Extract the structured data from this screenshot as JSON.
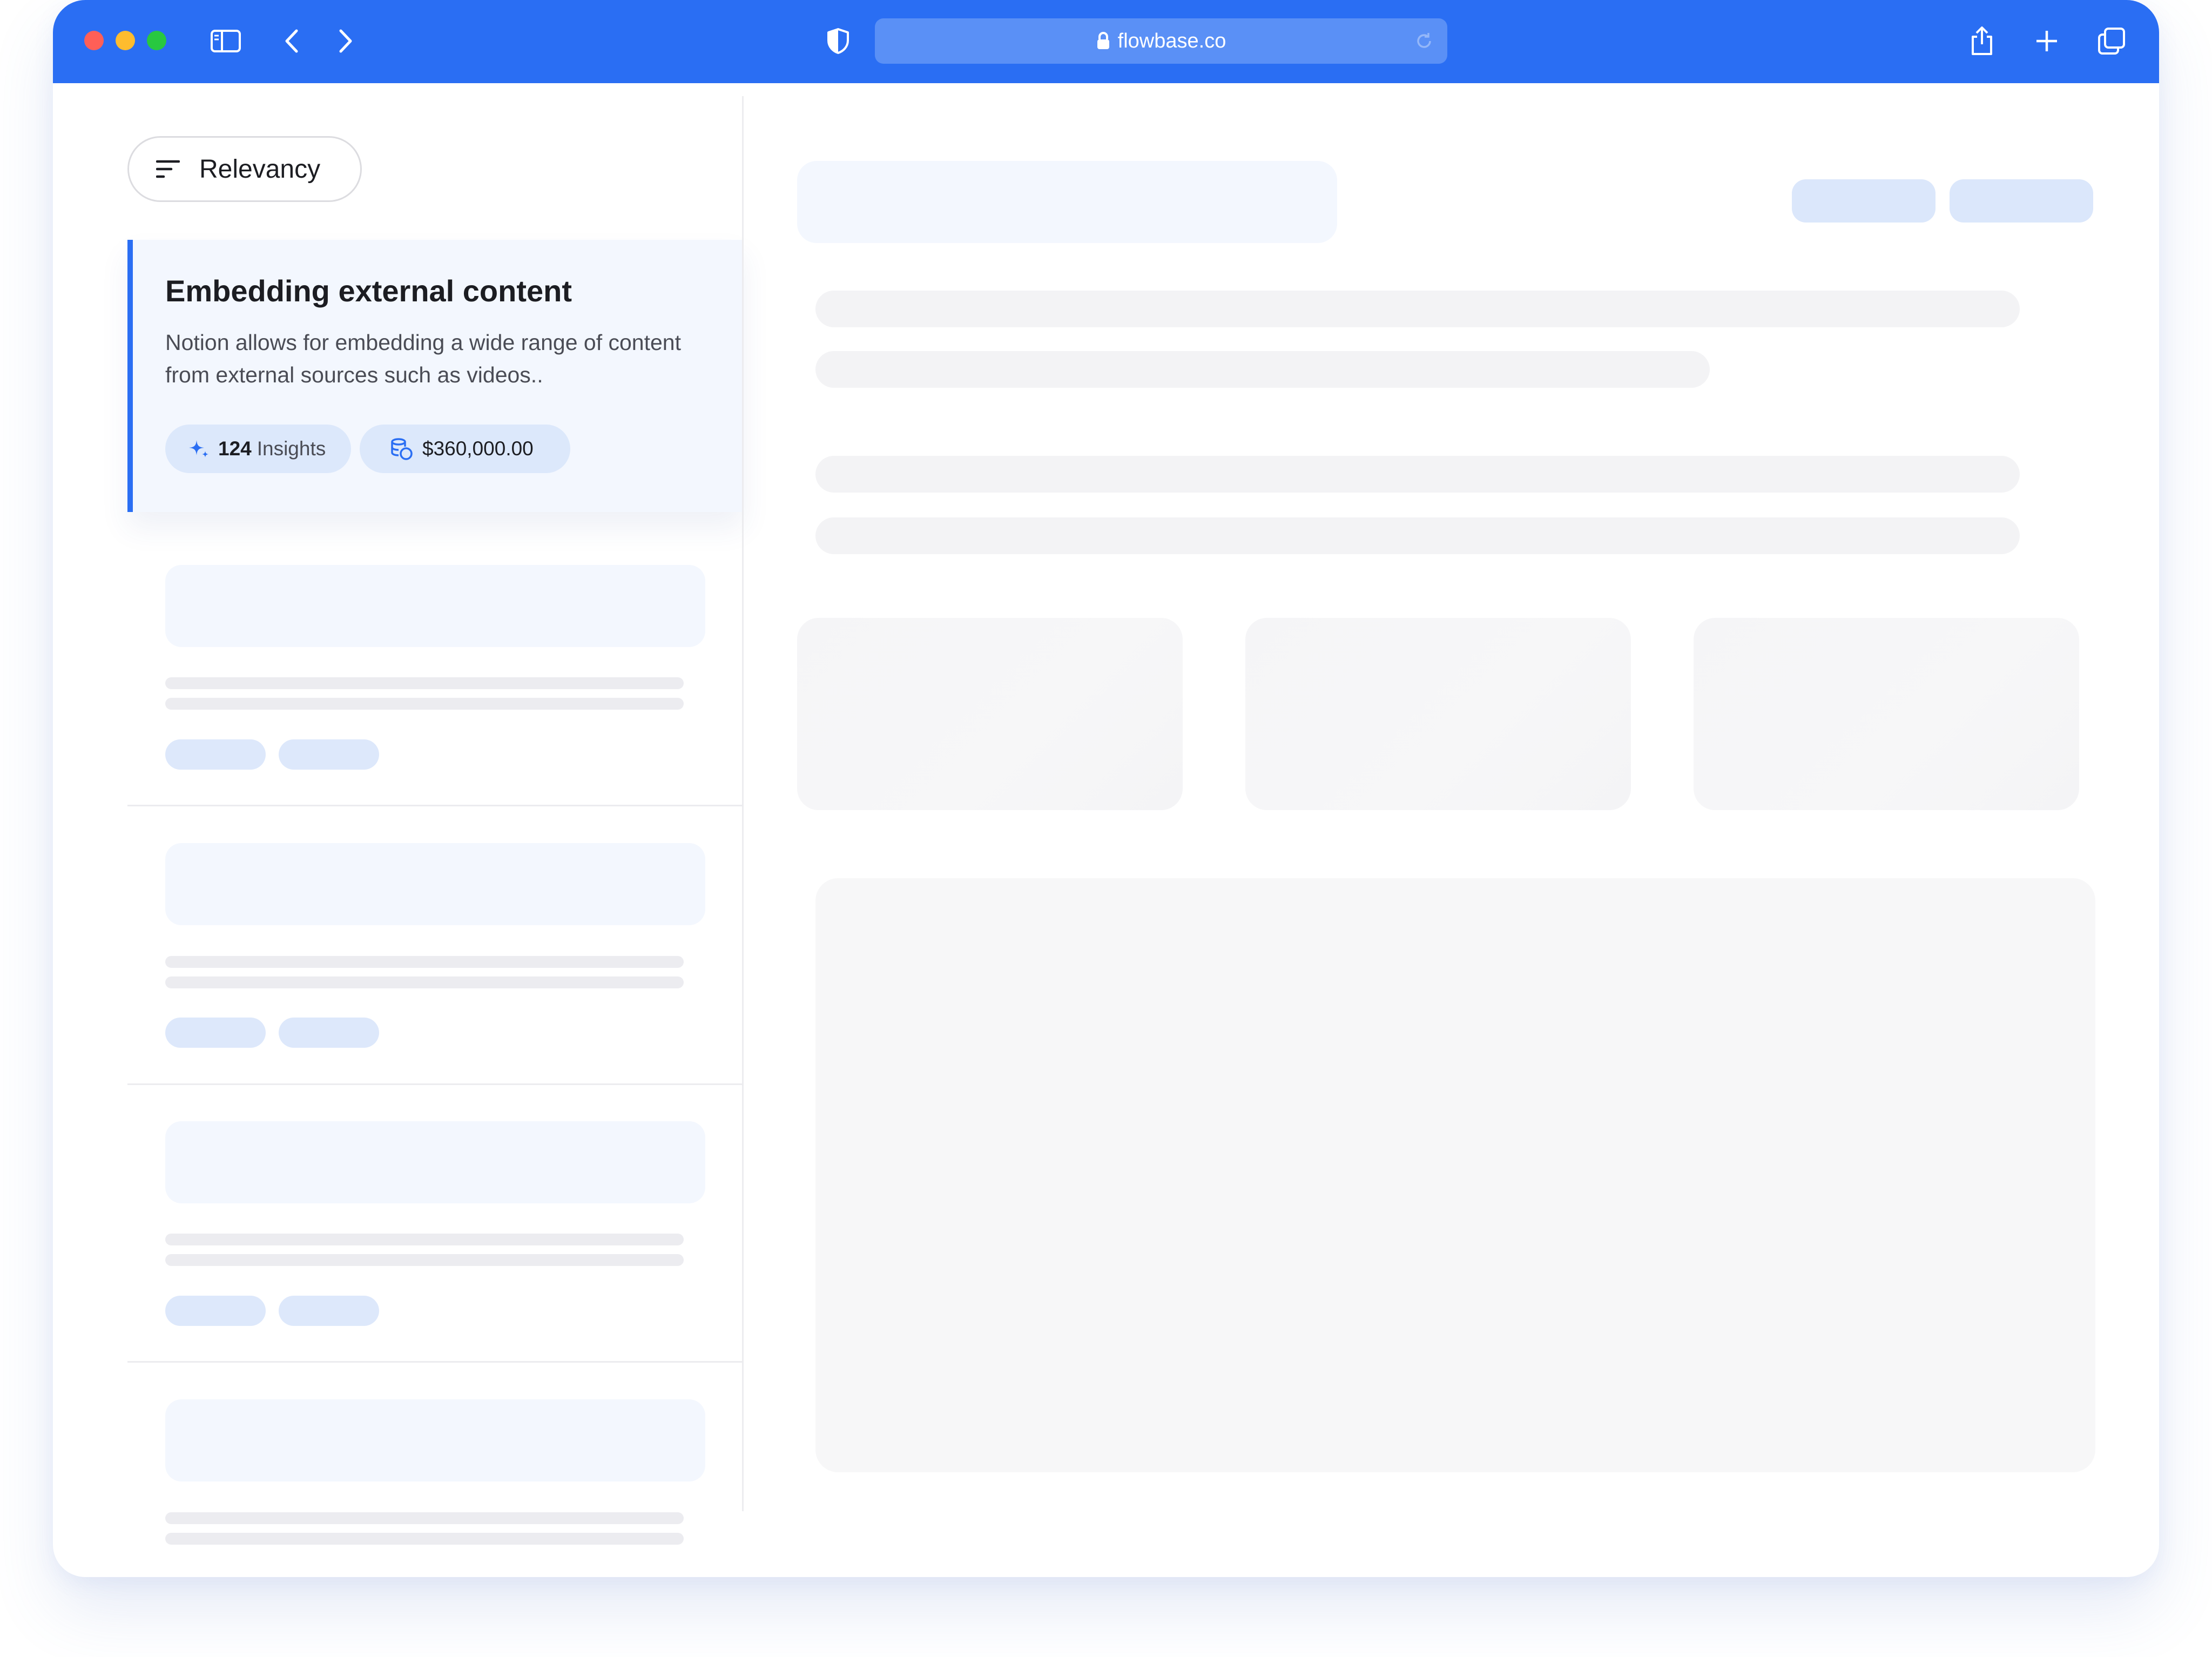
{
  "browser": {
    "url": "flowbase.co",
    "colors": {
      "chrome": "#2a6ef3",
      "address_bar": "#5a90f6"
    },
    "icons": [
      "sidebar-icon",
      "chevron-left-icon",
      "chevron-right-icon",
      "shield-icon",
      "lock-icon",
      "reload-icon",
      "share-icon",
      "plus-icon",
      "tabs-icon"
    ]
  },
  "sidebar": {
    "sort": {
      "label": "Relevancy",
      "icon": "sort-icon"
    },
    "selected_card": {
      "title": "Embedding external content",
      "description": "Notion allows for embedding a wide range of content from external sources such as videos..",
      "insights_count": "124",
      "insights_label": "Insights",
      "amount": "$360,000.00",
      "accent_color": "#2a6ef3"
    }
  }
}
